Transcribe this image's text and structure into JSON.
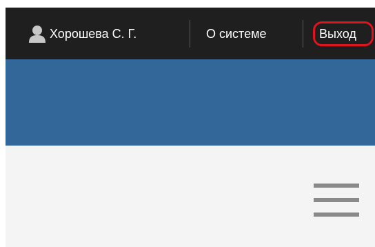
{
  "topbar": {
    "user_name": "Хорошева С. Г.",
    "user_icon": "user-icon",
    "about_label": "О системе",
    "logout_label": "Выход"
  },
  "menu": {
    "icon": "hamburger-menu-icon"
  },
  "colors": {
    "topbar_bg": "#1f1f1f",
    "banner_bg": "#336799",
    "content_bg": "#f4f4f4",
    "highlight_outline": "#e0141e",
    "menu_icon": "#8a8a8a"
  }
}
